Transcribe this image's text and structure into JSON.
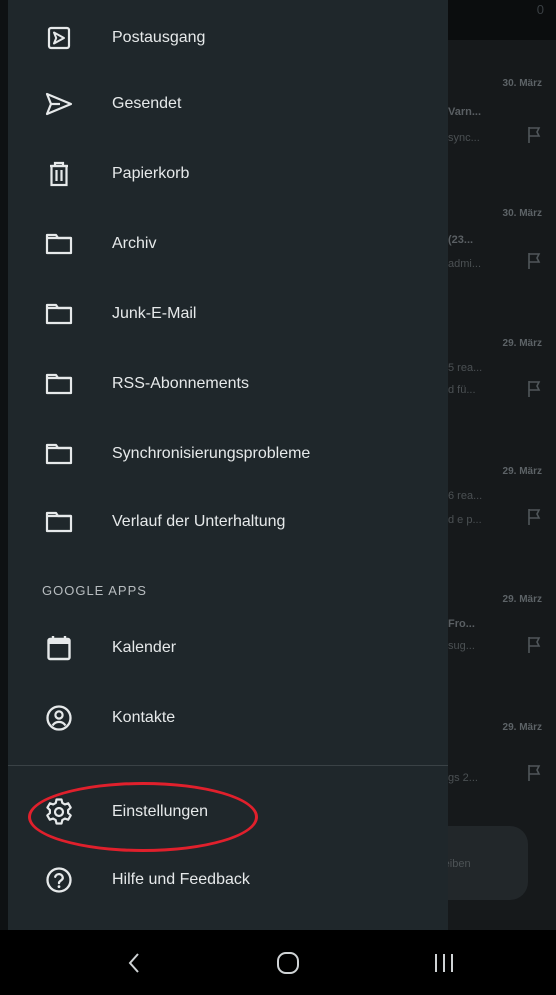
{
  "drawer": {
    "items": [
      {
        "label": "Postausgang",
        "icon": "outbox-icon"
      },
      {
        "label": "Gesendet",
        "icon": "send-icon"
      },
      {
        "label": "Papierkorb",
        "icon": "trash-icon"
      },
      {
        "label": "Archiv",
        "icon": "folder-icon"
      },
      {
        "label": "Junk-E-Mail",
        "icon": "folder-icon"
      },
      {
        "label": "RSS-Abonnements",
        "icon": "folder-icon"
      },
      {
        "label": "Synchronisierungsprobleme",
        "icon": "folder-icon"
      },
      {
        "label": "Verlauf der Unterhaltung",
        "icon": "folder-icon"
      }
    ],
    "google_apps_header": "GOOGLE APPS",
    "google_apps": [
      {
        "label": "Kalender",
        "icon": "calendar-icon"
      },
      {
        "label": "Kontakte",
        "icon": "contacts-icon"
      }
    ],
    "footer": [
      {
        "label": "Einstellungen",
        "icon": "gear-icon"
      },
      {
        "label": "Hilfe und Feedback",
        "icon": "help-icon"
      }
    ]
  },
  "background_list": {
    "count": "0",
    "items": [
      {
        "date": "30. März",
        "line1": "Varn...",
        "line2": "sync..."
      },
      {
        "date": "30. März",
        "line1": "(23...",
        "line2": "admi..."
      },
      {
        "date": "29. März",
        "line1": "5 rea...",
        "line2": "d fü..."
      },
      {
        "date": "29. März",
        "line1": "6 rea...",
        "line2": "d e p..."
      },
      {
        "date": "29. März",
        "line1": "Fro...",
        "line2": "sug..."
      },
      {
        "date": "29. März",
        "line1": "",
        "line2": "gs 2..."
      }
    ],
    "compose_label": "reiben"
  },
  "navbar": {
    "back": "back-icon",
    "home": "home-icon",
    "recents": "recents-icon"
  },
  "colors": {
    "drawer_bg": "#1f272b",
    "text": "#e6e9ea",
    "annotation": "#e0202c"
  }
}
